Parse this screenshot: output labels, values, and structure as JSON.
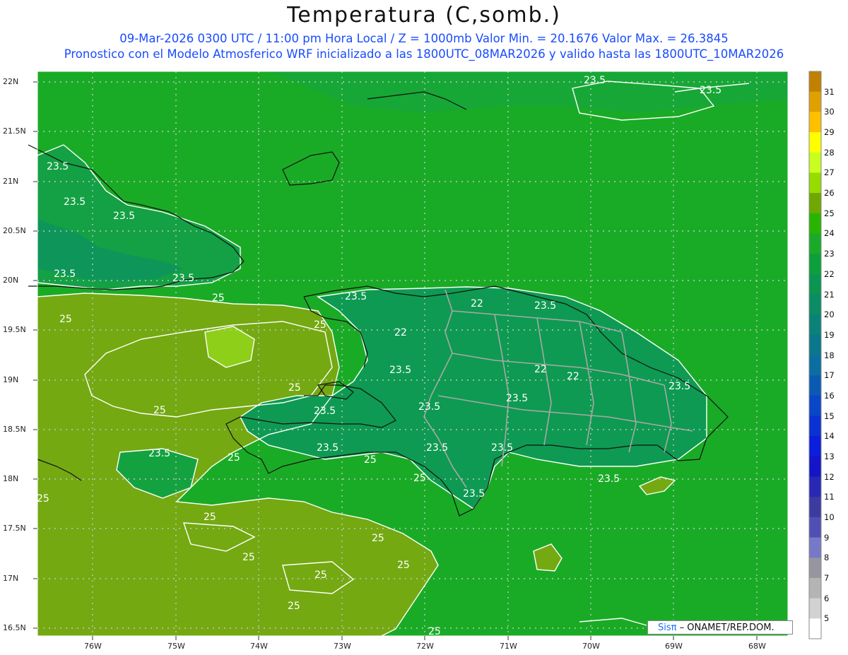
{
  "header": {
    "title": "Temperatura (C,somb.)",
    "line1": "09-Mar-2026 0300 UTC / 11:00 pm Hora Local / Z = 1000mb  Valor Min. = 20.1676  Valor Max. = 26.3845",
    "line2": "Pronostico con el Modelo Atmosferico WRF inicializado a las 1800UTC_08MAR2026 y valido hasta las  1800UTC_10MAR2026"
  },
  "axes": {
    "lat_labels": [
      "22N",
      "21.5N",
      "21N",
      "20.5N",
      "20N",
      "19.5N",
      "19N",
      "18.5N",
      "18N",
      "17.5N",
      "17N",
      "16.5N"
    ],
    "lon_labels": [
      "76W",
      "75W",
      "74W",
      "73W",
      "72W",
      "71W",
      "70W",
      "69W",
      "68W"
    ]
  },
  "colorbar": {
    "labels": [
      "31",
      "30",
      "29",
      "28",
      "27",
      "26",
      "25",
      "24",
      "23",
      "22",
      "21",
      "20",
      "19",
      "18",
      "17",
      "16",
      "15",
      "14",
      "13",
      "12",
      "11",
      "10",
      "9",
      "8",
      "7",
      "6",
      "5"
    ],
    "colors": [
      "#c08000",
      "#e0a000",
      "#ffc000",
      "#ffff00",
      "#c8ff20",
      "#96dc00",
      "#6ea800",
      "#28b400",
      "#1aaa28",
      "#0ca03c",
      "#0a9650",
      "#0a8c64",
      "#0a8278",
      "#0a788c",
      "#0a6ea0",
      "#0a5ab4",
      "#0a46c8",
      "#0a32d2",
      "#0a1edc",
      "#1414c8",
      "#2828b4",
      "#3c3ca0",
      "#5050b4",
      "#7878c8",
      "#9696a0",
      "#b4b4b4",
      "#d2d2d2",
      "#ffffff"
    ]
  },
  "contour_labels": [
    "23.5",
    "25",
    "22"
  ],
  "credit": {
    "sis": "Sisπ",
    "rest": " – ONAMET/REP.DOM."
  }
}
